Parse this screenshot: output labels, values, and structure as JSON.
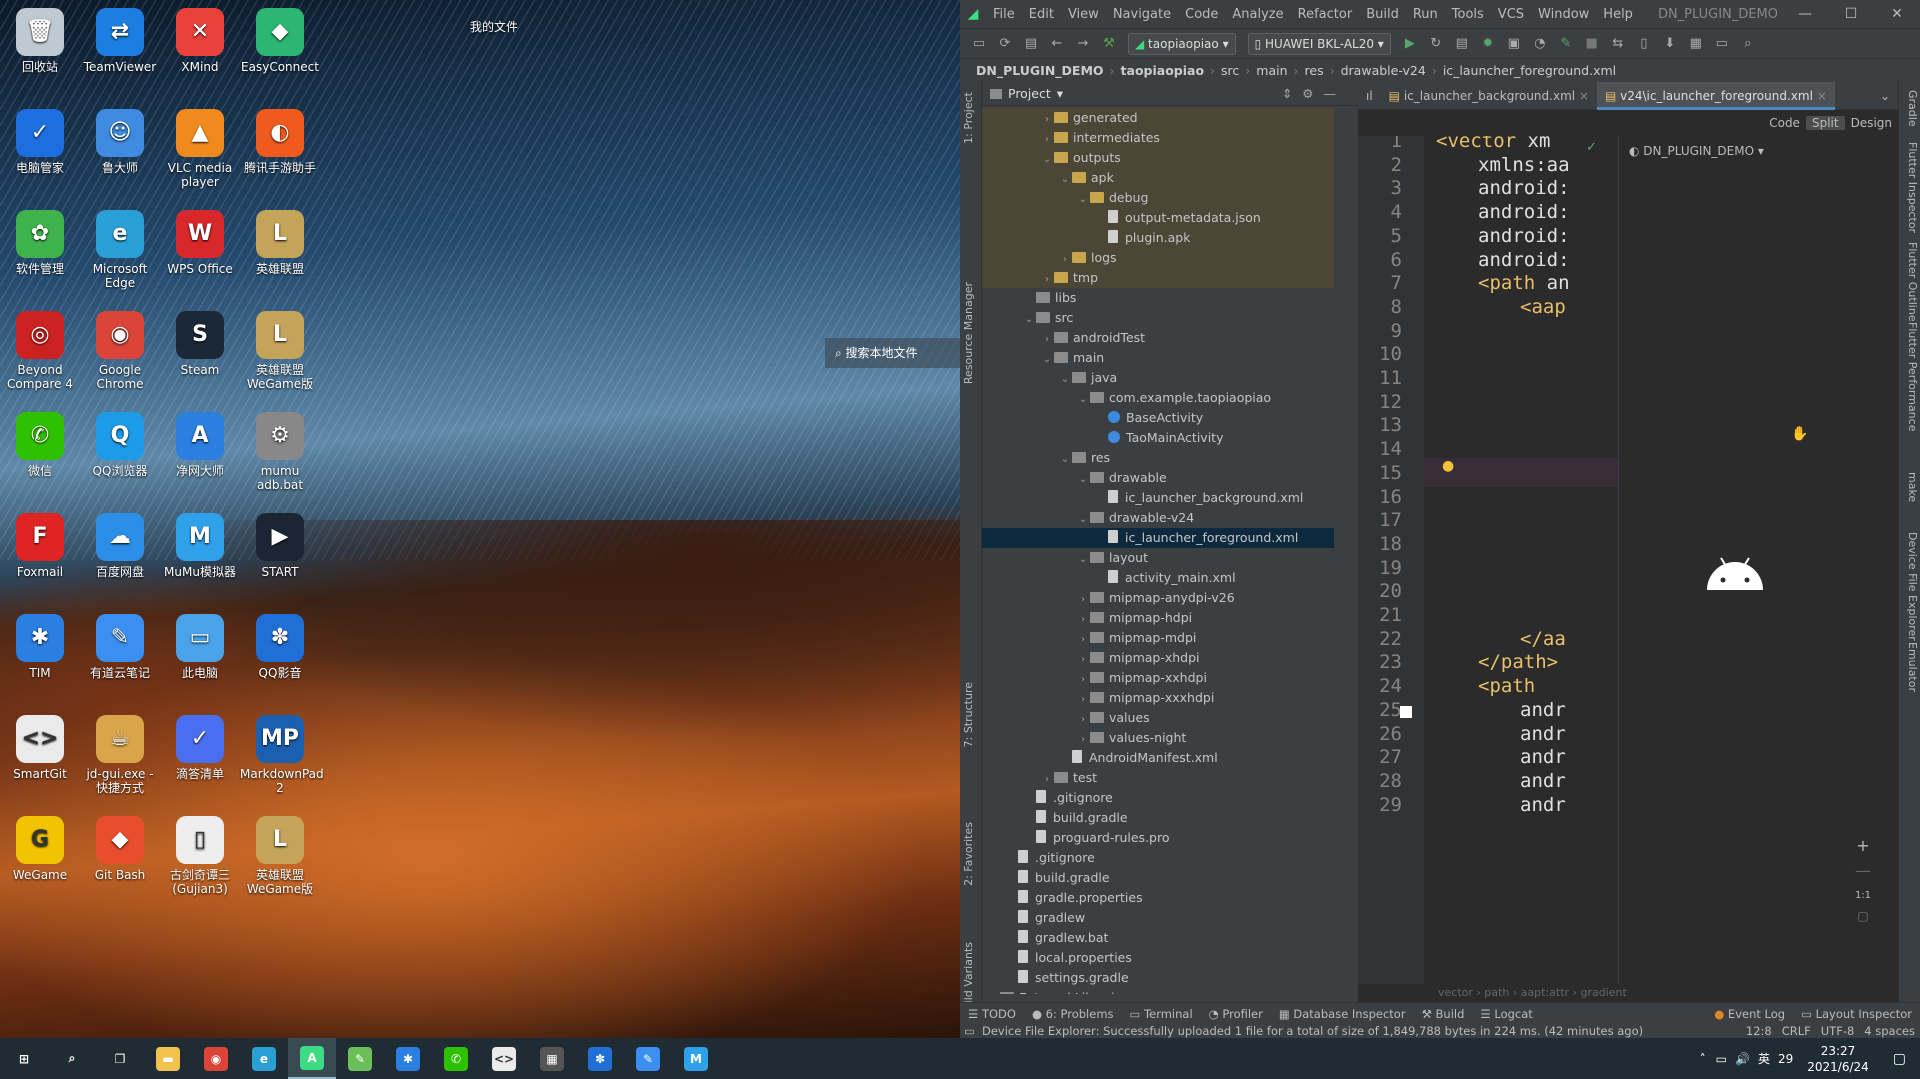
{
  "desktop": {
    "floating_label": "我的文件",
    "search_label": "搜索本地文件",
    "icons": [
      {
        "label": "回收站",
        "glyph": "🗑",
        "color": "#bfc9d2"
      },
      {
        "label": "TeamViewer",
        "glyph": "⇄",
        "color": "#1c7ee0"
      },
      {
        "label": "XMind",
        "glyph": "✕",
        "color": "#e8423a"
      },
      {
        "label": "EasyConnect",
        "glyph": "◆",
        "color": "#2bb673"
      },
      {
        "label": "电脑管家",
        "glyph": "✓",
        "color": "#1d6fe0"
      },
      {
        "label": "鲁大师",
        "glyph": "☺",
        "color": "#3e8be0"
      },
      {
        "label": "VLC media player",
        "glyph": "▲",
        "color": "#f08a1c"
      },
      {
        "label": "腾讯手游助手",
        "glyph": "◐",
        "color": "#f05a1c"
      },
      {
        "label": "软件管理",
        "glyph": "✿",
        "color": "#3cb44b"
      },
      {
        "label": "Microsoft Edge",
        "glyph": "e",
        "color": "#2a9fd6"
      },
      {
        "label": "WPS Office",
        "glyph": "W",
        "color": "#d8282c"
      },
      {
        "label": "英雄联盟",
        "glyph": "L",
        "color": "#c4a35a"
      },
      {
        "label": "Beyond Compare 4",
        "glyph": "◎",
        "color": "#c22"
      },
      {
        "label": "Google Chrome",
        "glyph": "◉",
        "color": "#db4437"
      },
      {
        "label": "Steam",
        "glyph": "S",
        "color": "#1b2838"
      },
      {
        "label": "英雄联盟WeGame版",
        "glyph": "L",
        "color": "#c4a35a"
      },
      {
        "label": "微信",
        "glyph": "✆",
        "color": "#2dc100"
      },
      {
        "label": "QQ浏览器",
        "glyph": "Q",
        "color": "#1c9be8"
      },
      {
        "label": "净网大师",
        "glyph": "A",
        "color": "#2a7fe0"
      },
      {
        "label": "mumu adb.bat",
        "glyph": "⚙",
        "color": "#888"
      },
      {
        "label": "Foxmail",
        "glyph": "F",
        "color": "#e02424"
      },
      {
        "label": "百度网盘",
        "glyph": "☁",
        "color": "#2b8fe8"
      },
      {
        "label": "MuMu模拟器",
        "glyph": "M",
        "color": "#2fa0ea"
      },
      {
        "label": "START",
        "glyph": "▶",
        "color": "#1a2634"
      },
      {
        "label": "TIM",
        "glyph": "✱",
        "color": "#2a7fe0"
      },
      {
        "label": "有道云笔记",
        "glyph": "✎",
        "color": "#3a8ff0"
      },
      {
        "label": "此电脑",
        "glyph": "▭",
        "color": "#4aa3e8"
      },
      {
        "label": "QQ影音",
        "glyph": "✽",
        "color": "#1f6fd6"
      },
      {
        "label": "SmartGit",
        "glyph": "<>",
        "color": "#eaeaea"
      },
      {
        "label": "jd-gui.exe - 快捷方式",
        "glyph": "☕",
        "color": "#d9a44a"
      },
      {
        "label": "滴答清单",
        "glyph": "✓",
        "color": "#4a6ef0"
      },
      {
        "label": "MarkdownPad 2",
        "glyph": "MP",
        "color": "#1b5fb0"
      },
      {
        "label": "WeGame",
        "glyph": "G",
        "color": "#f2c300"
      },
      {
        "label": "Git Bash",
        "glyph": "◆",
        "color": "#e84d2e"
      },
      {
        "label": "古剑奇谭三(Gujian3)",
        "glyph": "▯",
        "color": "#eee"
      },
      {
        "label": "英雄联盟WeGame版",
        "glyph": "L",
        "color": "#c4a35a"
      }
    ]
  },
  "ide": {
    "menus": [
      "File",
      "Edit",
      "View",
      "Navigate",
      "Code",
      "Analyze",
      "Refactor",
      "Build",
      "Run",
      "Tools",
      "VCS",
      "Window",
      "Help"
    ],
    "window_title": "DN_PLUGIN_DEMO",
    "run_config": "taopiaopiao",
    "device": "HUAWEI BKL-AL20",
    "breadcrumb": [
      "DN_PLUGIN_DEMO",
      "taopiaopiao",
      "src",
      "main",
      "res",
      "drawable-v24",
      "ic_launcher_foreground.xml"
    ],
    "project_header": "Project",
    "tree": [
      {
        "label": "generated",
        "depth": 3,
        "kind": "foldo",
        "arrow": "›",
        "excl": true
      },
      {
        "label": "intermediates",
        "depth": 3,
        "kind": "foldo",
        "arrow": "›",
        "excl": true
      },
      {
        "label": "outputs",
        "depth": 3,
        "kind": "foldo",
        "arrow": "⌄",
        "excl": true
      },
      {
        "label": "apk",
        "depth": 4,
        "kind": "foldo",
        "arrow": "⌄",
        "excl": true
      },
      {
        "label": "debug",
        "depth": 5,
        "kind": "foldo",
        "arrow": "⌄",
        "excl": true
      },
      {
        "label": "output-metadata.json",
        "depth": 6,
        "kind": "file",
        "arrow": "",
        "excl": true
      },
      {
        "label": "plugin.apk",
        "depth": 6,
        "kind": "file",
        "arrow": "",
        "excl": true
      },
      {
        "label": "logs",
        "depth": 4,
        "kind": "foldo",
        "arrow": "›",
        "excl": true
      },
      {
        "label": "tmp",
        "depth": 3,
        "kind": "foldo",
        "arrow": "›",
        "excl": true
      },
      {
        "label": "libs",
        "depth": 2,
        "kind": "fold",
        "arrow": ""
      },
      {
        "label": "src",
        "depth": 2,
        "kind": "fold",
        "arrow": "⌄"
      },
      {
        "label": "androidTest",
        "depth": 3,
        "kind": "fold",
        "arrow": "›"
      },
      {
        "label": "main",
        "depth": 3,
        "kind": "fold",
        "arrow": "⌄"
      },
      {
        "label": "java",
        "depth": 4,
        "kind": "fold",
        "arrow": "⌄"
      },
      {
        "label": "com.example.taopiaopiao",
        "depth": 5,
        "kind": "fold",
        "arrow": "⌄"
      },
      {
        "label": "BaseActivity",
        "depth": 6,
        "kind": "cls",
        "arrow": ""
      },
      {
        "label": "TaoMainActivity",
        "depth": 6,
        "kind": "cls",
        "arrow": ""
      },
      {
        "label": "res",
        "depth": 4,
        "kind": "fold",
        "arrow": "⌄"
      },
      {
        "label": "drawable",
        "depth": 5,
        "kind": "fold",
        "arrow": "⌄"
      },
      {
        "label": "ic_launcher_background.xml",
        "depth": 6,
        "kind": "file",
        "arrow": ""
      },
      {
        "label": "drawable-v24",
        "depth": 5,
        "kind": "fold",
        "arrow": "⌄"
      },
      {
        "label": "ic_launcher_foreground.xml",
        "depth": 6,
        "kind": "file",
        "arrow": "",
        "selected": true
      },
      {
        "label": "layout",
        "depth": 5,
        "kind": "fold",
        "arrow": "⌄"
      },
      {
        "label": "activity_main.xml",
        "depth": 6,
        "kind": "file",
        "arrow": ""
      },
      {
        "label": "mipmap-anydpi-v26",
        "depth": 5,
        "kind": "fold",
        "arrow": "›"
      },
      {
        "label": "mipmap-hdpi",
        "depth": 5,
        "kind": "fold",
        "arrow": "›"
      },
      {
        "label": "mipmap-mdpi",
        "depth": 5,
        "kind": "fold",
        "arrow": "›"
      },
      {
        "label": "mipmap-xhdpi",
        "depth": 5,
        "kind": "fold",
        "arrow": "›"
      },
      {
        "label": "mipmap-xxhdpi",
        "depth": 5,
        "kind": "fold",
        "arrow": "›"
      },
      {
        "label": "mipmap-xxxhdpi",
        "depth": 5,
        "kind": "fold",
        "arrow": "›"
      },
      {
        "label": "values",
        "depth": 5,
        "kind": "fold",
        "arrow": "›"
      },
      {
        "label": "values-night",
        "depth": 5,
        "kind": "fold",
        "arrow": "›"
      },
      {
        "label": "AndroidManifest.xml",
        "depth": 4,
        "kind": "file",
        "arrow": ""
      },
      {
        "label": "test",
        "depth": 3,
        "kind": "fold",
        "arrow": "›"
      },
      {
        "label": ".gitignore",
        "depth": 2,
        "kind": "file",
        "arrow": ""
      },
      {
        "label": "build.gradle",
        "depth": 2,
        "kind": "file",
        "arrow": ""
      },
      {
        "label": "proguard-rules.pro",
        "depth": 2,
        "kind": "file",
        "arrow": ""
      },
      {
        "label": ".gitignore",
        "depth": 1,
        "kind": "file",
        "arrow": ""
      },
      {
        "label": "build.gradle",
        "depth": 1,
        "kind": "file",
        "arrow": ""
      },
      {
        "label": "gradle.properties",
        "depth": 1,
        "kind": "file",
        "arrow": ""
      },
      {
        "label": "gradlew",
        "depth": 1,
        "kind": "file",
        "arrow": ""
      },
      {
        "label": "gradlew.bat",
        "depth": 1,
        "kind": "file",
        "arrow": ""
      },
      {
        "label": "local.properties",
        "depth": 1,
        "kind": "file",
        "arrow": ""
      },
      {
        "label": "settings.gradle",
        "depth": 1,
        "kind": "file",
        "arrow": ""
      },
      {
        "label": "External Libraries",
        "depth": 0,
        "kind": "fold",
        "arrow": "›"
      }
    ],
    "tabs": [
      "ic_launcher_background.xml",
      "v24\\ic_launcher_foreground.xml"
    ],
    "modes": [
      "Code",
      "Split",
      "Design"
    ],
    "code_lines": [
      {
        "n": "1",
        "indent": 0,
        "tag": "<vector",
        "rest": " xm"
      },
      {
        "n": "2",
        "indent": 1,
        "tag": "",
        "rest": "xmlns:aa"
      },
      {
        "n": "3",
        "indent": 1,
        "tag": "",
        "rest": "android:"
      },
      {
        "n": "4",
        "indent": 1,
        "tag": "",
        "rest": "android:"
      },
      {
        "n": "5",
        "indent": 1,
        "tag": "",
        "rest": "android:"
      },
      {
        "n": "6",
        "indent": 1,
        "tag": "",
        "rest": "android:"
      },
      {
        "n": "7",
        "indent": 1,
        "tag": "<path",
        "rest": " an"
      },
      {
        "n": "8",
        "indent": 2,
        "tag": "<aap",
        "rest": ""
      },
      {
        "n": "9",
        "indent": 0,
        "tag": "",
        "rest": ""
      },
      {
        "n": "10",
        "indent": 0,
        "tag": "",
        "rest": ""
      },
      {
        "n": "11",
        "indent": 0,
        "tag": "",
        "rest": ""
      },
      {
        "n": "12",
        "indent": 0,
        "tag": "",
        "rest": ""
      },
      {
        "n": "13",
        "indent": 0,
        "tag": "",
        "rest": ""
      },
      {
        "n": "14",
        "indent": 0,
        "tag": "",
        "rest": ""
      },
      {
        "n": "15",
        "indent": 0,
        "tag": "",
        "rest": ""
      },
      {
        "n": "16",
        "indent": 0,
        "tag": "",
        "rest": ""
      },
      {
        "n": "17",
        "indent": 0,
        "tag": "",
        "rest": ""
      },
      {
        "n": "18",
        "indent": 0,
        "tag": "",
        "rest": ""
      },
      {
        "n": "19",
        "indent": 0,
        "tag": "",
        "rest": ""
      },
      {
        "n": "20",
        "indent": 0,
        "tag": "",
        "rest": ""
      },
      {
        "n": "21",
        "indent": 0,
        "tag": "",
        "rest": ""
      },
      {
        "n": "22",
        "indent": 2,
        "tag": "</aa",
        "rest": ""
      },
      {
        "n": "23",
        "indent": 1,
        "tag": "</path>",
        "rest": ""
      },
      {
        "n": "24",
        "indent": 1,
        "tag": "<path",
        "rest": ""
      },
      {
        "n": "25",
        "indent": 2,
        "tag": "",
        "rest": "andr"
      },
      {
        "n": "26",
        "indent": 2,
        "tag": "",
        "rest": "andr"
      },
      {
        "n": "27",
        "indent": 2,
        "tag": "",
        "rest": "andr"
      },
      {
        "n": "28",
        "indent": 2,
        "tag": "",
        "rest": "andr"
      },
      {
        "n": "29",
        "indent": 2,
        "tag": "",
        "rest": "andr"
      }
    ],
    "preview_header": "DN_PLUGIN_DEMO",
    "editor_breadcrumb": "vector  ›  path  ›  aapt:attr  ›  gradient",
    "zoom_ratio": "1:1",
    "bottom_tools": [
      "TODO",
      "6: Problems",
      "Terminal",
      "Profiler",
      "Database Inspector",
      "Build",
      "Logcat"
    ],
    "bottom_right_tools": [
      "Event Log",
      "Layout Inspector"
    ],
    "status_message": "Device File Explorer: Successfully uploaded 1 file for a total of size of 1,849,788 bytes in 224 ms. (42 minutes ago)",
    "status_right": [
      "12:8",
      "CRLF",
      "UTF-8",
      "4 spaces"
    ],
    "left_vtabs": [
      "1: Project",
      "Resource Manager",
      "7: Structure",
      "2: Favorites",
      "Build Variants"
    ],
    "right_vtabs": [
      "Gradle",
      "Flutter Inspector",
      "Flutter Outline",
      "Flutter Performance",
      "make",
      "Device File Explorer",
      "Emulator"
    ]
  },
  "taskbar": {
    "time": "23:27",
    "date": "2021/6/24",
    "ime": "英",
    "temp_badge": "29",
    "apps": [
      {
        "name": "start",
        "glyph": "⊞",
        "color": "#1f2c33"
      },
      {
        "name": "search",
        "glyph": "⌕",
        "color": "#1f2c33"
      },
      {
        "name": "task-view",
        "glyph": "❐",
        "color": "#1f2c33"
      },
      {
        "name": "file-explorer",
        "glyph": "▬",
        "color": "#f2c14e"
      },
      {
        "name": "chrome",
        "glyph": "◉",
        "color": "#db4437"
      },
      {
        "name": "edge",
        "glyph": "e",
        "color": "#2a9fd6"
      },
      {
        "name": "ide",
        "glyph": "A",
        "color": "#3ddc84"
      },
      {
        "name": "notepad",
        "glyph": "✎",
        "color": "#6bbf59"
      },
      {
        "name": "tim",
        "glyph": "✱",
        "color": "#2a7fe0"
      },
      {
        "name": "wechat",
        "glyph": "✆",
        "color": "#2dc100"
      },
      {
        "name": "smartgit",
        "glyph": "<>",
        "color": "#eaeaea"
      },
      {
        "name": "calculator",
        "glyph": "▦",
        "color": "#555"
      },
      {
        "name": "qq-player",
        "glyph": "✽",
        "color": "#1f6fd6"
      },
      {
        "name": "youdao-note",
        "glyph": "✎",
        "color": "#3a8ff0"
      },
      {
        "name": "mumu",
        "glyph": "M",
        "color": "#2fa0ea"
      }
    ]
  }
}
